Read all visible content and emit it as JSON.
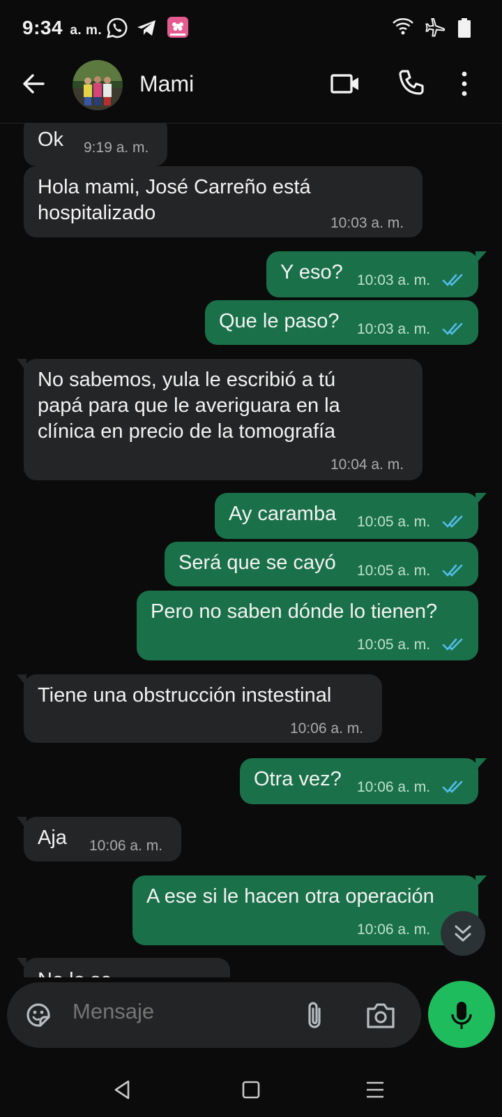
{
  "status_bar": {
    "time": "9:34",
    "ampm": "a. m.",
    "left_icons": [
      "whatsapp-icon",
      "telegram-icon",
      "gallery-app-icon"
    ],
    "right_icons": [
      "wifi-icon",
      "airplane-mode-icon",
      "battery-icon"
    ]
  },
  "header": {
    "contact_name": "Mami",
    "actions": [
      "video-call-icon",
      "phone-call-icon",
      "more-options-icon"
    ]
  },
  "messages": [
    {
      "dir": "in",
      "text": "Ok",
      "time": "9:19 a. m."
    },
    {
      "dir": "in",
      "text": "Hola mami, José Carreño está\nhospitalizado",
      "time": "10:03 a. m."
    },
    {
      "dir": "out",
      "text": "Y eso?",
      "time": "10:03 a. m.",
      "read": true
    },
    {
      "dir": "out",
      "text": "Que le paso?",
      "time": "10:03 a. m.",
      "read": true
    },
    {
      "dir": "in",
      "text": "No sabemos, yula le escribió a tú\npapá para que le averiguara en la\nclínica en precio de la tomografía",
      "time": "10:04 a. m."
    },
    {
      "dir": "out",
      "text": "Ay caramba",
      "time": "10:05 a. m.",
      "read": true
    },
    {
      "dir": "out",
      "text": "Será que se cayó",
      "time": "10:05 a. m.",
      "read": true
    },
    {
      "dir": "out",
      "text": "Pero no saben dónde lo tienen?",
      "time": "10:05 a. m.",
      "read": true
    },
    {
      "dir": "in",
      "text": "Tiene una obstrucción instestinal",
      "time": "10:06 a. m."
    },
    {
      "dir": "out",
      "text": "Otra vez?",
      "time": "10:06 a. m.",
      "read": true
    },
    {
      "dir": "in",
      "text": "Aja",
      "time": "10:06 a. m."
    },
    {
      "dir": "out",
      "text": "A ese si le hacen otra operación",
      "time": "10:06 a. m.",
      "read": true
    },
    {
      "dir": "in",
      "text": "No lo se",
      "time": ""
    }
  ],
  "composer": {
    "placeholder": "Mensaje",
    "icons": [
      "sticker-icon",
      "attach-icon",
      "camera-icon",
      "mic-icon"
    ]
  },
  "nav": [
    "back-nav-icon",
    "home-nav-icon",
    "recents-nav-icon"
  ],
  "colors": {
    "background": "#0b0b0c",
    "incoming_bubble": "#242526",
    "outgoing_bubble": "#1a7149",
    "read_ticks": "#53bdeb",
    "mic_button": "#1fbc5d"
  }
}
